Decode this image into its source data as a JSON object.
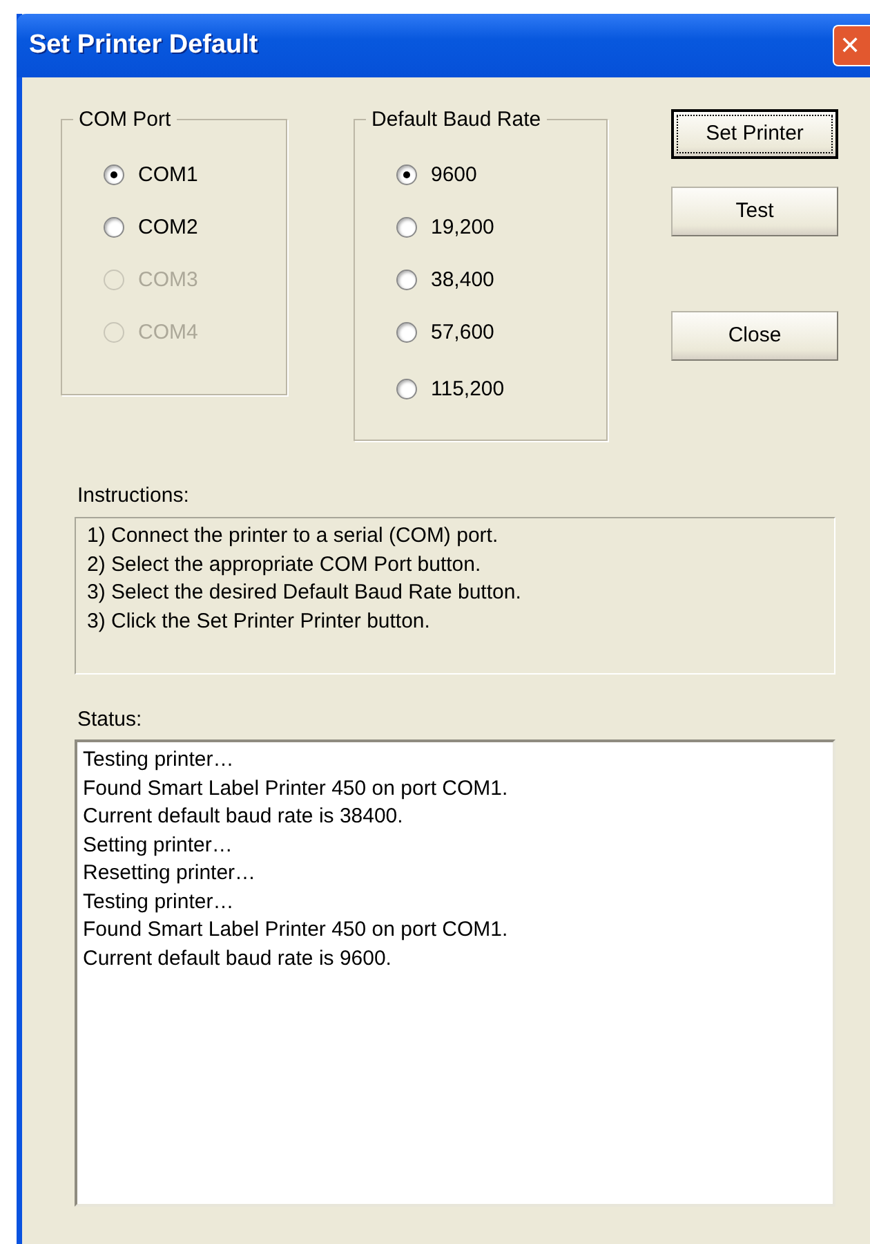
{
  "window": {
    "title": "Set Printer Default",
    "close_label": "✕"
  },
  "com_port": {
    "label": "COM Port",
    "options": [
      {
        "label": "COM1",
        "selected": true,
        "disabled": false
      },
      {
        "label": "COM2",
        "selected": false,
        "disabled": false
      },
      {
        "label": "COM3",
        "selected": false,
        "disabled": true
      },
      {
        "label": "COM4",
        "selected": false,
        "disabled": true
      }
    ]
  },
  "baud_rate": {
    "label": "Default Baud Rate",
    "options": [
      {
        "label": "9600",
        "selected": true,
        "disabled": false
      },
      {
        "label": "19,200",
        "selected": false,
        "disabled": false
      },
      {
        "label": "38,400",
        "selected": false,
        "disabled": false
      },
      {
        "label": "57,600",
        "selected": false,
        "disabled": false
      },
      {
        "label": "115,200",
        "selected": false,
        "disabled": false
      }
    ]
  },
  "buttons": [
    {
      "label": "Set Printer",
      "focused": true
    },
    {
      "label": "Test",
      "focused": false
    },
    {
      "label": "Close",
      "focused": false
    }
  ],
  "instructions": {
    "label": "Instructions:",
    "lines": [
      "1) Connect the printer to a serial (COM) port.",
      "2) Select the appropriate COM Port button.",
      "3) Select the desired Default Baud Rate button.",
      "3) Click the Set Printer Printer button."
    ]
  },
  "status": {
    "label": "Status:",
    "lines": [
      "Testing printer…",
      "Found Smart Label Printer 450 on port COM1.",
      "Current default baud rate is 38400.",
      "Setting printer…",
      "Resetting printer…",
      "Testing printer…",
      "Found Smart Label Printer 450 on port COM1.",
      "Current default baud rate is 9600."
    ]
  }
}
